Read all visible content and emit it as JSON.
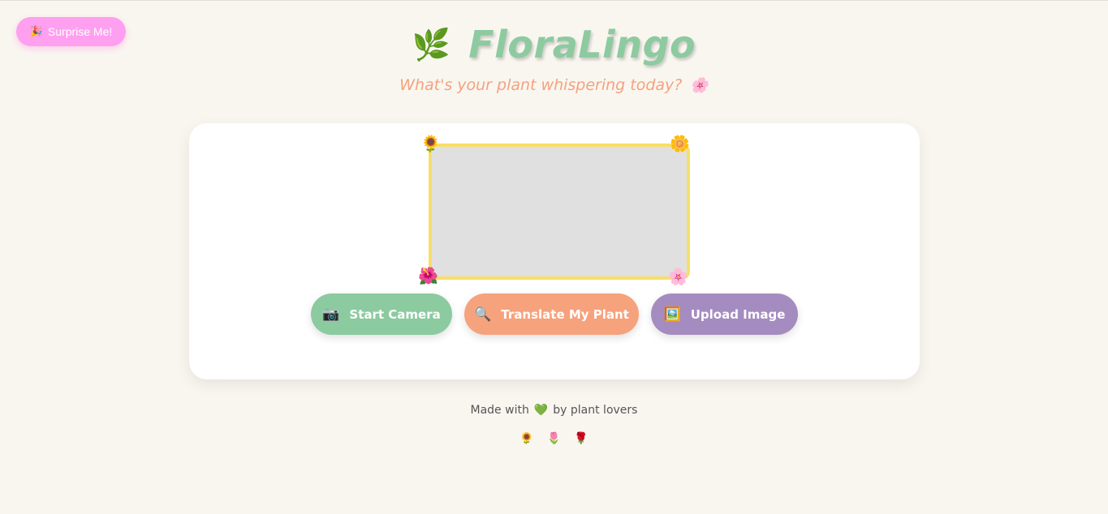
{
  "surprise_button": {
    "icon": "party-popper-icon",
    "glyph": "🎉",
    "label": "Surprise Me!"
  },
  "header": {
    "icon": "herb-icon",
    "icon_glyph": "🌿",
    "title": "FloraLingo",
    "subtitle": "What's your plant whispering today?",
    "subtitle_icon_glyph": "🌸"
  },
  "preview": {
    "corner_glyphs": {
      "top_left": "🌻",
      "top_right": "🌼",
      "bottom_left": "🌺",
      "bottom_right": "🌸"
    }
  },
  "buttons": [
    {
      "icon": "camera-icon",
      "glyph": "📷",
      "label": "Start Camera"
    },
    {
      "icon": "magnifier-icon",
      "glyph": "🔍",
      "label": "Translate My Plant"
    },
    {
      "icon": "picture-icon",
      "glyph": "🖼️",
      "label": "Upload Image"
    }
  ],
  "footer": {
    "text_before": "Made with",
    "heart_glyph": "💚",
    "text_after": "by plant lovers",
    "flowers": [
      "🌻",
      "🌷",
      "🌹"
    ]
  },
  "colors": {
    "background": "#f9f6f0",
    "title": "#8dcaa0",
    "subtitle": "#f4a27d",
    "surprise": "#ff9ff0",
    "camera": "#8ccaa0",
    "translate": "#f6a27c",
    "upload": "#a58cc0",
    "frame": "#f8df66"
  }
}
